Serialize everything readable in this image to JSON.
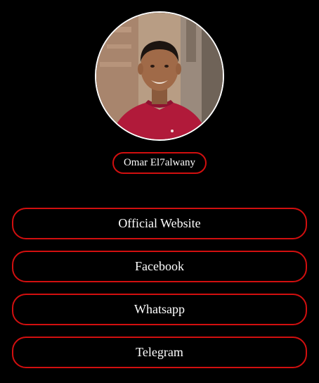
{
  "profile": {
    "name": "Omar El7alwany"
  },
  "links": [
    {
      "label": "Official Website"
    },
    {
      "label": "Facebook"
    },
    {
      "label": "Whatsapp"
    },
    {
      "label": "Telegram"
    }
  ],
  "colors": {
    "background": "#000000",
    "accent": "#d10f0f",
    "text": "#ffffff"
  }
}
